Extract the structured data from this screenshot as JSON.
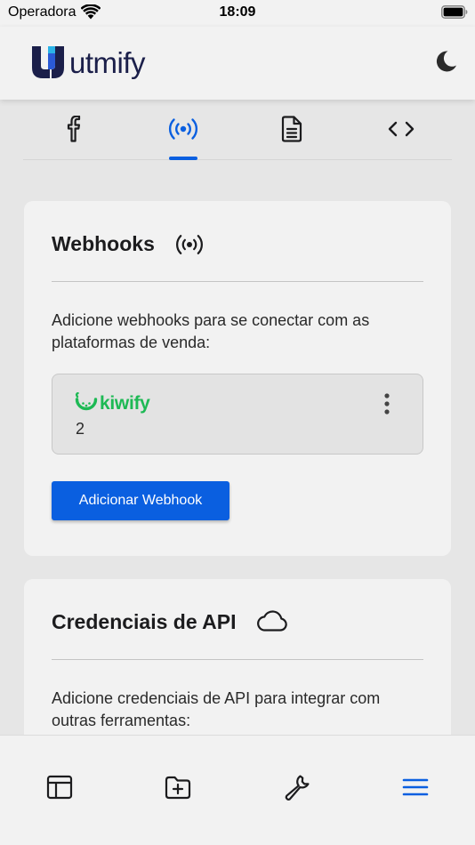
{
  "status_bar": {
    "carrier": "Operadora",
    "time": "18:09"
  },
  "header": {
    "brand": "utmify",
    "theme_icon": "moon-icon"
  },
  "tabs": [
    {
      "icon": "facebook-icon",
      "active": false
    },
    {
      "icon": "broadcast-icon",
      "active": true
    },
    {
      "icon": "document-icon",
      "active": false
    },
    {
      "icon": "code-icon",
      "active": false
    }
  ],
  "webhooks": {
    "title": "Webhooks",
    "icon": "broadcast-icon",
    "description": "Adicione webhooks para se conectar com as plataformas de venda:",
    "items": [
      {
        "platform": "kiwify",
        "count": "2"
      }
    ],
    "add_button": "Adicionar Webhook"
  },
  "api": {
    "title": "Credenciais de API",
    "icon": "cloud-icon",
    "description": "Adicione credenciais de API para integrar com outras ferramentas:"
  },
  "bottom_nav": [
    {
      "icon": "layout-icon",
      "active": false
    },
    {
      "icon": "folder-plus-icon",
      "active": false
    },
    {
      "icon": "wrench-icon",
      "active": false
    },
    {
      "icon": "menu-icon",
      "active": true
    }
  ],
  "colors": {
    "accent": "#0a5fe0",
    "kiwify": "#1db954",
    "brand": "#1b1f4a"
  }
}
